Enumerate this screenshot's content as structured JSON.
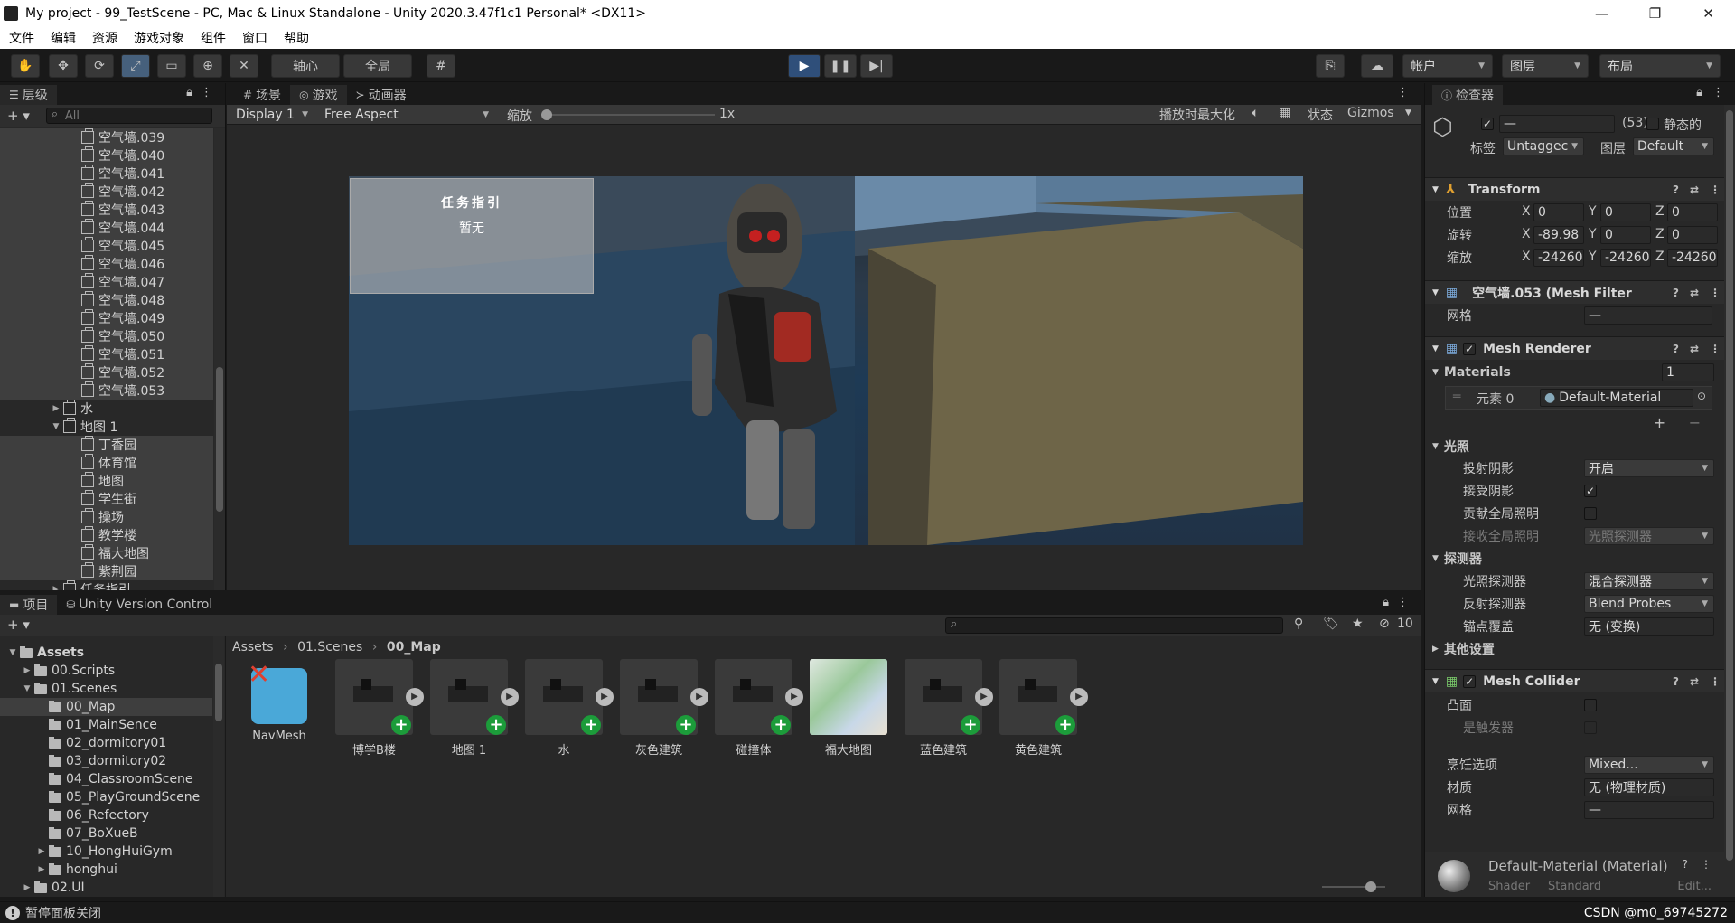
{
  "window": {
    "title": "My project - 99_TestScene - PC, Mac & Linux Standalone - Unity 2020.3.47f1c1 Personal* <DX11>",
    "min": "—",
    "max": "❐",
    "close": "✕"
  },
  "menu": [
    "文件",
    "编辑",
    "资源",
    "游戏对象",
    "组件",
    "窗口",
    "帮助"
  ],
  "toolbar": {
    "pivot": "轴心",
    "global": "全局",
    "account": "帐户",
    "layers": "图层",
    "layout": "布局",
    "play": "▶",
    "pause": "❚❚",
    "step": "▶|"
  },
  "hierarchy": {
    "tab": "层级",
    "search_placeholder": "All",
    "items": [
      {
        "label": "空气墙.039",
        "indent": 2
      },
      {
        "label": "空气墙.040",
        "indent": 2
      },
      {
        "label": "空气墙.041",
        "indent": 2
      },
      {
        "label": "空气墙.042",
        "indent": 2
      },
      {
        "label": "空气墙.043",
        "indent": 2
      },
      {
        "label": "空气墙.044",
        "indent": 2
      },
      {
        "label": "空气墙.045",
        "indent": 2
      },
      {
        "label": "空气墙.046",
        "indent": 2
      },
      {
        "label": "空气墙.047",
        "indent": 2
      },
      {
        "label": "空气墙.048",
        "indent": 2
      },
      {
        "label": "空气墙.049",
        "indent": 2
      },
      {
        "label": "空气墙.050",
        "indent": 2
      },
      {
        "label": "空气墙.051",
        "indent": 2
      },
      {
        "label": "空气墙.052",
        "indent": 2
      },
      {
        "label": "空气墙.053",
        "indent": 2
      },
      {
        "label": "水",
        "indent": 1
      },
      {
        "label": "地图 1",
        "indent": 1
      },
      {
        "label": "丁香园",
        "indent": 2
      },
      {
        "label": "体育馆",
        "indent": 2
      },
      {
        "label": "地图",
        "indent": 2
      },
      {
        "label": "学生街",
        "indent": 2
      },
      {
        "label": "操场",
        "indent": 2
      },
      {
        "label": "教学楼",
        "indent": 2
      },
      {
        "label": "福大地图",
        "indent": 2
      },
      {
        "label": "紫荆园",
        "indent": 2
      },
      {
        "label": "任务指引",
        "indent": 1
      }
    ]
  },
  "game": {
    "tabs": [
      "场景",
      "游戏",
      "动画器"
    ],
    "display": "Display 1",
    "aspect": "Free Aspect",
    "scale_label": "缩放",
    "scale_value": "1x",
    "maximize": "播放时最大化",
    "stats": "状态",
    "gizmos": "Gizmos",
    "task_title": "任务指引",
    "task_body": "暂无"
  },
  "inspector": {
    "tab": "检查器",
    "name_value": "—",
    "count": "(53)",
    "static": "静态的",
    "tag_label": "标签",
    "tag_value": "Untaggec",
    "layer_label": "图层",
    "layer_value": "Default",
    "transform": {
      "title": "Transform",
      "position": "位置",
      "rotation": "旋转",
      "scale": "缩放",
      "pos": [
        "0",
        "0",
        "0"
      ],
      "rot": [
        "-89.98",
        "0",
        "0"
      ],
      "scl": [
        "-24260",
        "-24260",
        "-24260"
      ]
    },
    "mesh_filter": {
      "title": "空气墙.053 (Mesh Filter",
      "mesh_label": "网格",
      "mesh_value": "—"
    },
    "mesh_renderer": {
      "title": "Mesh Renderer",
      "materials": "Materials",
      "materials_count": "1",
      "element_label": "元素 0",
      "element_value": "Default-Material",
      "lighting": "光照",
      "cast_shadows": "投射阴影",
      "cast_value": "开启",
      "receive_shadows": "接受阴影",
      "contribute_gi": "贡献全局照明",
      "receive_gi": "接收全局照明",
      "receive_gi_value": "光照探测器",
      "probes": "探测器",
      "light_probes": "光照探测器",
      "light_probes_value": "混合探测器",
      "reflection_probes": "反射探测器",
      "reflection_value": "Blend Probes",
      "anchor": "锚点覆盖",
      "anchor_value": "无 (变换)",
      "other": "其他设置"
    },
    "mesh_collider": {
      "title": "Mesh Collider",
      "convex": "凸面",
      "trigger": "是触发器",
      "cooking": "烹饪选项",
      "cooking_value": "Mixed...",
      "material": "材质",
      "material_value": "无 (物理材质)",
      "mesh": "网格",
      "mesh_value": "—"
    },
    "material_preview": "Default-Material (Material)",
    "shader_label": "Shader",
    "shader_value": "Standard",
    "edit": "Edit..."
  },
  "project": {
    "tabs": [
      "项目",
      "Unity Version Control"
    ],
    "hidden_count": "10",
    "breadcrumb": [
      "Assets",
      "01.Scenes",
      "00_Map"
    ],
    "tree": [
      {
        "label": "Assets",
        "indent": 0,
        "bold": true
      },
      {
        "label": "00.Scripts",
        "indent": 1
      },
      {
        "label": "01.Scenes",
        "indent": 1
      },
      {
        "label": "00_Map",
        "indent": 2
      },
      {
        "label": "01_MainSence",
        "indent": 2
      },
      {
        "label": "02_dormitory01",
        "indent": 2
      },
      {
        "label": "03_dormitory02",
        "indent": 2
      },
      {
        "label": "04_ClassroomScene",
        "indent": 2
      },
      {
        "label": "05_PlayGroundScene",
        "indent": 2
      },
      {
        "label": "06_Refectory",
        "indent": 2
      },
      {
        "label": "07_BoXueB",
        "indent": 2
      },
      {
        "label": "10_HongHuiGym",
        "indent": 2
      },
      {
        "label": "honghui",
        "indent": 2
      },
      {
        "label": "02.UI",
        "indent": 1
      }
    ],
    "assets": [
      "NavMesh",
      "博学B楼",
      "地图 1",
      "水",
      "灰色建筑",
      "碰撞体",
      "福大地图",
      "蓝色建筑",
      "黄色建筑"
    ]
  },
  "status": {
    "message": "暂停面板关闭",
    "watermark": "CSDN @m0_69745272"
  }
}
